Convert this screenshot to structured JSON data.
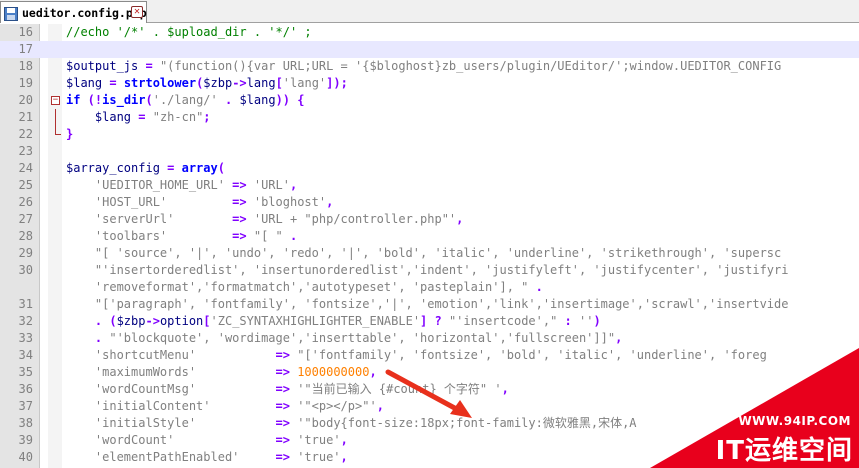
{
  "tab": {
    "filename": "ueditor.config.php",
    "icon": "save-disk-icon",
    "close_icon": "close-icon"
  },
  "lines": [
    {
      "n": "16",
      "segs": [
        [
          "cm",
          "//echo '/*' . $upload_dir . '*/' ;"
        ]
      ]
    },
    {
      "n": "17",
      "segs": []
    },
    {
      "n": "18",
      "segs": [
        [
          "var",
          "$output_js"
        ],
        [
          "op",
          " = "
        ],
        [
          "str",
          "\"(function(){var URL;URL = '{$bloghost}zb_users/plugin/UEditor/';window.UEDITOR_CONFIG"
        ]
      ]
    },
    {
      "n": "19",
      "segs": [
        [
          "var",
          "$lang"
        ],
        [
          "op",
          " = "
        ],
        [
          "kw",
          "strtolower"
        ],
        [
          "op",
          "("
        ],
        [
          "var",
          "$zbp"
        ],
        [
          "op",
          "->"
        ],
        [
          "var",
          "lang"
        ],
        [
          "op",
          "["
        ],
        [
          "str",
          "'lang'"
        ],
        [
          "op",
          "]);"
        ]
      ]
    },
    {
      "n": "20",
      "segs": [
        [
          "kw",
          "if"
        ],
        [
          "op",
          " (!"
        ],
        [
          "kw",
          "is_dir"
        ],
        [
          "op",
          "("
        ],
        [
          "str",
          "'./lang/'"
        ],
        [
          "op",
          " . "
        ],
        [
          "var",
          "$lang"
        ],
        [
          "op",
          ")) {"
        ]
      ]
    },
    {
      "n": "21",
      "segs": [
        [
          "var",
          "    $lang"
        ],
        [
          "op",
          " = "
        ],
        [
          "str",
          "\"zh-cn\""
        ],
        [
          "op",
          ";"
        ]
      ]
    },
    {
      "n": "22",
      "segs": [
        [
          "op",
          "}"
        ]
      ]
    },
    {
      "n": "23",
      "segs": []
    },
    {
      "n": "24",
      "segs": [
        [
          "var",
          "$array_config"
        ],
        [
          "op",
          " = "
        ],
        [
          "kw",
          "array"
        ],
        [
          "op",
          "("
        ]
      ]
    },
    {
      "n": "25",
      "segs": [
        [
          "str",
          "    'UEDITOR_HOME_URL'"
        ],
        [
          "op",
          " => "
        ],
        [
          "str",
          "'URL'"
        ],
        [
          "op",
          ","
        ]
      ]
    },
    {
      "n": "26",
      "segs": [
        [
          "str",
          "    'HOST_URL'"
        ],
        [
          "op",
          "         => "
        ],
        [
          "str",
          "'bloghost'"
        ],
        [
          "op",
          ","
        ]
      ]
    },
    {
      "n": "27",
      "segs": [
        [
          "str",
          "    'serverUrl'"
        ],
        [
          "op",
          "        => "
        ],
        [
          "str",
          "'URL + \"php/controller.php\"'"
        ],
        [
          "op",
          ","
        ]
      ]
    },
    {
      "n": "28",
      "segs": [
        [
          "str",
          "    'toolbars'"
        ],
        [
          "op",
          "         => "
        ],
        [
          "str",
          "\"[ \""
        ],
        [
          "op",
          " ."
        ]
      ]
    },
    {
      "n": "29",
      "segs": [
        [
          "str",
          "    \"[ 'source', '|', 'undo', 'redo', '|', 'bold', 'italic', 'underline', 'strikethrough', 'supersc"
        ]
      ]
    },
    {
      "n": "30",
      "segs": [
        [
          "str",
          "    \"'insertorderedlist', 'insertunorderedlist','indent', 'justifyleft', 'justifycenter', 'justifyri"
        ]
      ]
    },
    {
      "n": "",
      "segs": [
        [
          "str",
          "    'removeformat','formatmatch','autotypeset', 'pasteplain'], \""
        ],
        [
          "op",
          " ."
        ]
      ]
    },
    {
      "n": "31",
      "segs": [
        [
          "str",
          "    \"['paragraph', 'fontfamily', 'fontsize','|', 'emotion','link','insertimage','scrawl','insertvide"
        ]
      ]
    },
    {
      "n": "32",
      "segs": [
        [
          "op",
          "    . ("
        ],
        [
          "var",
          "$zbp"
        ],
        [
          "op",
          "->"
        ],
        [
          "var",
          "option"
        ],
        [
          "op",
          "["
        ],
        [
          "str",
          "'ZC_SYNTAXHIGHLIGHTER_ENABLE'"
        ],
        [
          "op",
          "] ? "
        ],
        [
          "str",
          "\"'insertcode',\""
        ],
        [
          "op",
          " : "
        ],
        [
          "str",
          "''"
        ],
        [
          "op",
          ")"
        ]
      ]
    },
    {
      "n": "33",
      "segs": [
        [
          "op",
          "    . "
        ],
        [
          "str",
          "\"'blockquote', 'wordimage','inserttable', 'horizontal','fullscreen']]\""
        ],
        [
          "op",
          ","
        ]
      ]
    },
    {
      "n": "34",
      "segs": [
        [
          "str",
          "    'shortcutMenu'"
        ],
        [
          "op",
          "           => "
        ],
        [
          "str",
          "\"['fontfamily', 'fontsize', 'bold', 'italic', 'underline', 'foreg"
        ]
      ]
    },
    {
      "n": "35",
      "segs": [
        [
          "str",
          "    'maximumWords'"
        ],
        [
          "op",
          "           => "
        ],
        [
          "num",
          "1000000000"
        ],
        [
          "op",
          ","
        ]
      ]
    },
    {
      "n": "36",
      "segs": [
        [
          "str",
          "    'wordCountMsg'"
        ],
        [
          "op",
          "           => "
        ],
        [
          "str",
          "'\"当前已输入 {#count} 个字符\" '"
        ],
        [
          "op",
          ","
        ]
      ]
    },
    {
      "n": "37",
      "segs": [
        [
          "str",
          "    'initialContent'"
        ],
        [
          "op",
          "         => "
        ],
        [
          "str",
          "'\"<p></p>\"'"
        ],
        [
          "op",
          ","
        ]
      ]
    },
    {
      "n": "38",
      "segs": [
        [
          "str",
          "    'initialStyle'"
        ],
        [
          "op",
          "           => "
        ],
        [
          "str",
          "'\"body{font-size:18px;font-family:微软雅黑,宋体,A"
        ]
      ]
    },
    {
      "n": "39",
      "segs": [
        [
          "str",
          "    'wordCount'"
        ],
        [
          "op",
          "              => "
        ],
        [
          "str",
          "'true'"
        ],
        [
          "op",
          ","
        ]
      ]
    },
    {
      "n": "40",
      "segs": [
        [
          "str",
          "    'elementPathEnabled'"
        ],
        [
          "op",
          "     => "
        ],
        [
          "str",
          "'true'"
        ],
        [
          "op",
          ","
        ]
      ]
    }
  ],
  "current_line": "17",
  "watermark": {
    "url": "WWW.94IP.COM",
    "name": "IT运维空间",
    "color": "#e8001c"
  }
}
